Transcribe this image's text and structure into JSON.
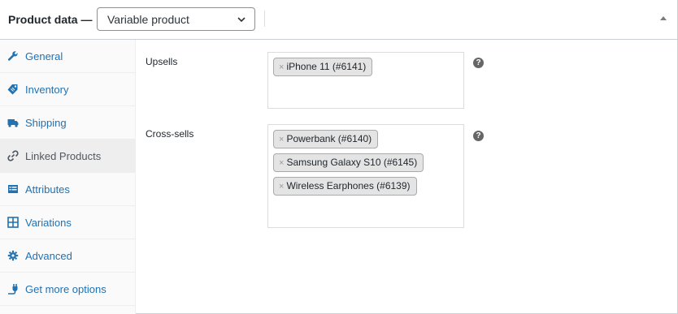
{
  "header": {
    "title": "Product data —",
    "product_type": "Variable product"
  },
  "tabs": [
    {
      "label": "General",
      "icon": "wrench-icon",
      "active": false
    },
    {
      "label": "Inventory",
      "icon": "tag-icon",
      "active": false
    },
    {
      "label": "Shipping",
      "icon": "truck-icon",
      "active": false
    },
    {
      "label": "Linked Products",
      "icon": "link-icon",
      "active": true
    },
    {
      "label": "Attributes",
      "icon": "list-icon",
      "active": false
    },
    {
      "label": "Variations",
      "icon": "grid-icon",
      "active": false
    },
    {
      "label": "Advanced",
      "icon": "gear-icon",
      "active": false
    },
    {
      "label": "Get more options",
      "icon": "plug-icon",
      "active": false
    }
  ],
  "upsells": {
    "label": "Upsells",
    "items": [
      "iPhone 11 (#6141)"
    ],
    "help": "?"
  },
  "crosssells": {
    "label": "Cross-sells",
    "items": [
      "Powerbank (#6140)",
      "Samsung Galaxy S10 (#6145)",
      "Wireless Earphones (#6139)"
    ],
    "help": "?"
  },
  "chip_remove": "×",
  "colors": {
    "link": "#2271b1",
    "border": "#ccd0d4",
    "active_tab_bg": "#eeeeee",
    "chip_bg": "#e4e4e4"
  }
}
